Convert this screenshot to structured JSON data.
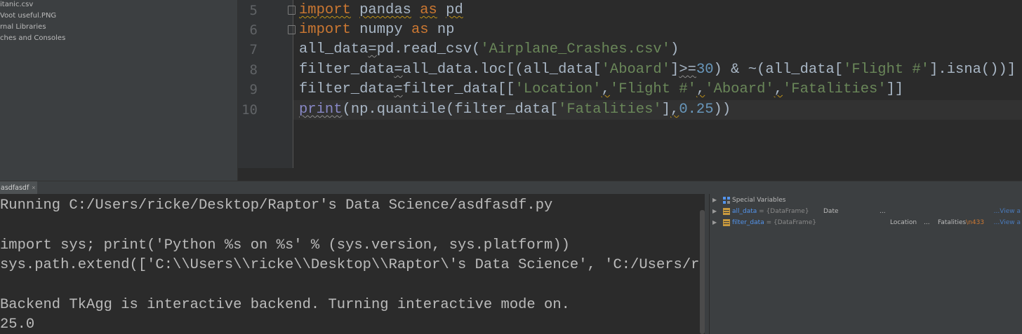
{
  "project_tree": {
    "items": [
      "itanic.csv",
      "Voot useful.PNG",
      "rnal Libraries",
      "ches and Consoles"
    ]
  },
  "editor": {
    "line_numbers": [
      "5",
      "6",
      "7",
      "8",
      "9",
      "10"
    ],
    "line5": {
      "kw1": "import",
      "mod": "pandas",
      "kw2": "as",
      "alias": "pd"
    },
    "line6": {
      "kw1": "import",
      "mod": "numpy",
      "kw2": "as",
      "alias": "np"
    },
    "line7": {
      "a": "all_data",
      "b": "=",
      "c": "pd.read_csv(",
      "d": "'Airplane_Crashes.csv'",
      "e": ")"
    },
    "line8": {
      "a": "filter_data",
      "b": "=",
      "c": "all_data.loc[(all_data[",
      "d": "'Aboard'",
      "e": "]",
      "f": ">=",
      "g": "30",
      "h": ") & ~(all_data[",
      "i": "'Flight #'",
      "j": "].isna())]"
    },
    "line9": {
      "a": "filter_data",
      "b": "=",
      "c": "filter_data[[",
      "d": "'Location'",
      "e": ",",
      "f": "'Flight #'",
      "g": ",",
      "h": "'Aboard'",
      "i": ",",
      "j": "'Fatalities'",
      "k": "]]"
    },
    "line10": {
      "a": "print",
      "b": "(np.quantile(filter_data[",
      "c": "'Fatalities'",
      "d": "]",
      "e": ",",
      "f": "0.25",
      "g": "))"
    }
  },
  "run": {
    "tab_label": "asdfasdf",
    "tab_close": "×",
    "console_lines": [
      "Running C:/Users/ricke/Desktop/Raptor's Data Science/asdfasdf.py",
      "",
      "import sys; print('Python %s on %s' % (sys.version, sys.platform))",
      "sys.path.extend(['C:\\\\Users\\\\ricke\\\\Desktop\\\\Raptor\\'s Data Science', 'C:/Users/ri",
      "",
      "Backend TkAgg is interactive backend. Turning interactive mode on.",
      "25.0"
    ]
  },
  "variables": {
    "special": "Special Variables",
    "rows": [
      {
        "name": "all_data",
        "type": " = {DataFrame}",
        "col1": "Date",
        "col2": "...",
        "col3": "",
        "col3b": "",
        "link": "...View a"
      },
      {
        "name": "filter_data",
        "type": " = {DataFrame}",
        "col1": "Location",
        "col2": "...",
        "col3": "Fatalities",
        "col3b": "\\n433",
        "link": "...View a"
      }
    ]
  },
  "colors": {
    "keyword": "#cc7832",
    "string": "#6a8759",
    "number": "#6897bb",
    "builtin": "#8888c6",
    "text": "#a9b7c6"
  }
}
